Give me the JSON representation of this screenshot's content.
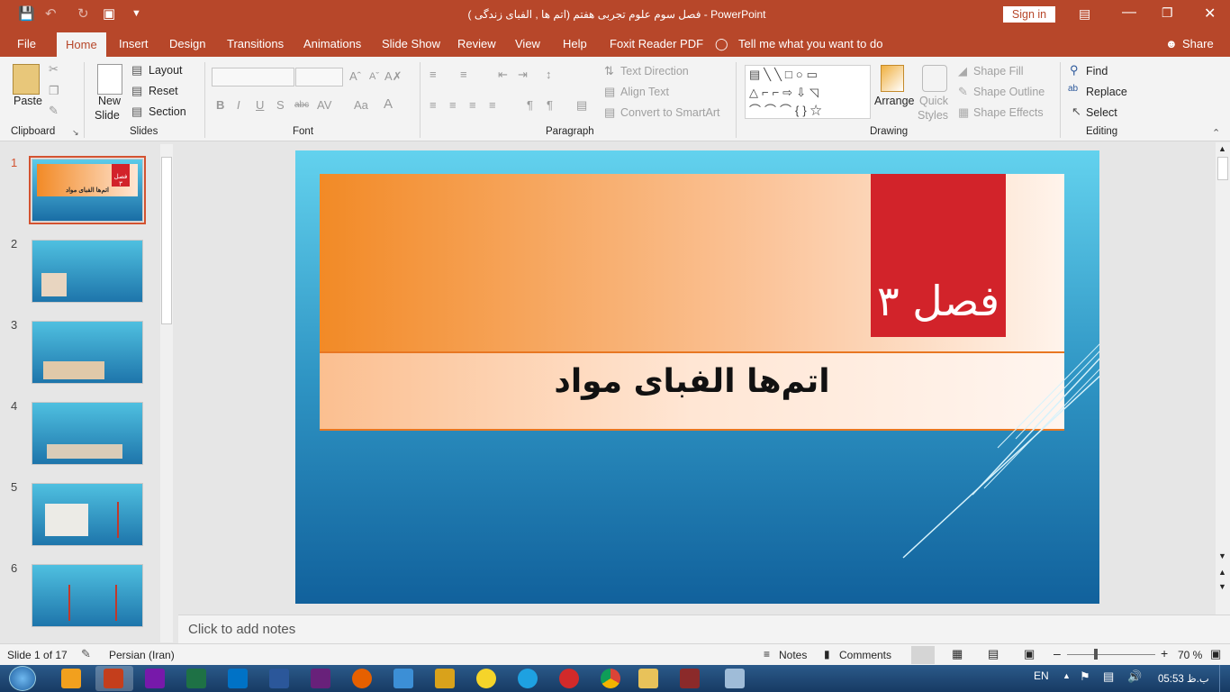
{
  "window": {
    "title": "فصل سوم علوم تجربی هفتم (اتم ها , الفبای زندگی )  -  PowerPoint",
    "sign_in": "Sign in"
  },
  "tabs": [
    "File",
    "Home",
    "Insert",
    "Design",
    "Transitions",
    "Animations",
    "Slide Show",
    "Review",
    "View",
    "Help",
    "Foxit Reader PDF"
  ],
  "tell_me": "Tell me what you want to do",
  "share": "Share",
  "ribbon": {
    "clipboard": {
      "paste": "Paste",
      "label": "Clipboard"
    },
    "slides": {
      "new_slide": "New",
      "new_slide2": "Slide",
      "layout": "Layout",
      "reset": "Reset",
      "section": "Section",
      "label": "Slides"
    },
    "font": {
      "label": "Font"
    },
    "paragraph": {
      "text_direction": "Text Direction",
      "align_text": "Align Text",
      "convert": "Convert to SmartArt",
      "label": "Paragraph"
    },
    "drawing": {
      "arrange": "Arrange",
      "quick": "Quick",
      "styles": "Styles",
      "shape_fill": "Shape Fill",
      "shape_outline": "Shape Outline",
      "shape_effects": "Shape Effects",
      "label": "Drawing"
    },
    "editing": {
      "find": "Find",
      "replace": "Replace",
      "select": "Select",
      "label": "Editing"
    }
  },
  "thumbnails": [
    "1",
    "2",
    "3",
    "4",
    "5",
    "6"
  ],
  "thumb1": {
    "t1": "فصل ۳",
    "t2": "اتم‌ها الفبای مواد"
  },
  "slide": {
    "chapter": "فصل ۳",
    "title": "اتم‌ها الفبای مواد"
  },
  "notes_placeholder": "Click to add notes",
  "status": {
    "slide": "Slide 1 of 17",
    "language": "Persian (Iran)",
    "notes": "Notes",
    "comments": "Comments",
    "zoom": "70 %"
  },
  "taskbar": {
    "lang": "EN",
    "time": "05:53 ب.ظ"
  },
  "colors": {
    "accent": "#b7472a",
    "red_box": "#d2232a"
  }
}
